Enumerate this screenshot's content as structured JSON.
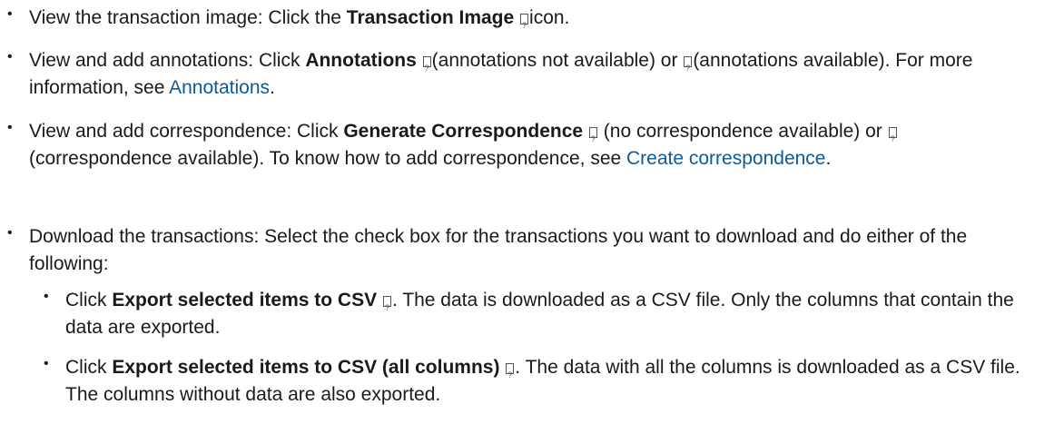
{
  "items": [
    {
      "prefix": "View the transaction image: Click the ",
      "bold": "Transaction Image",
      "icon": "transaction-image-icon",
      "suffix": "icon."
    },
    {
      "prefix": "View and add annotations: Click ",
      "bold": "Annotations",
      "icon1": "annotations-not-available-icon",
      "mid": "(annotations not available) or ",
      "icon2": "annotations-available-icon",
      "end": "(annotations available). For more information, see ",
      "link": "Annotations",
      "after": "."
    },
    {
      "prefix": "View and add correspondence: Click ",
      "bold": "Generate Correspondence",
      "icon1": "no-correspondence-icon",
      "mid": " (no correspondence available) or ",
      "icon2": "correspondence-available-icon",
      "end": "(correspondence available). To know how to add correspondence, see ",
      "link": "Create correspondence",
      "after": "."
    },
    {
      "text": "Download the transactions: Select the check box for the transactions you want to download and do either of the following:",
      "subitems": [
        {
          "prefix": "Click ",
          "bold": "Export selected items to CSV",
          "icon": "export-csv-icon",
          "suffix": ". The data is downloaded as a CSV file. Only the columns that contain the data are exported."
        },
        {
          "prefix": "Click ",
          "bold": "Export selected items to CSV (all columns)",
          "icon": "export-csv-all-columns-icon",
          "suffix": ". The data with all the columns is downloaded as a CSV file. The columns without data are also exported."
        }
      ]
    }
  ]
}
